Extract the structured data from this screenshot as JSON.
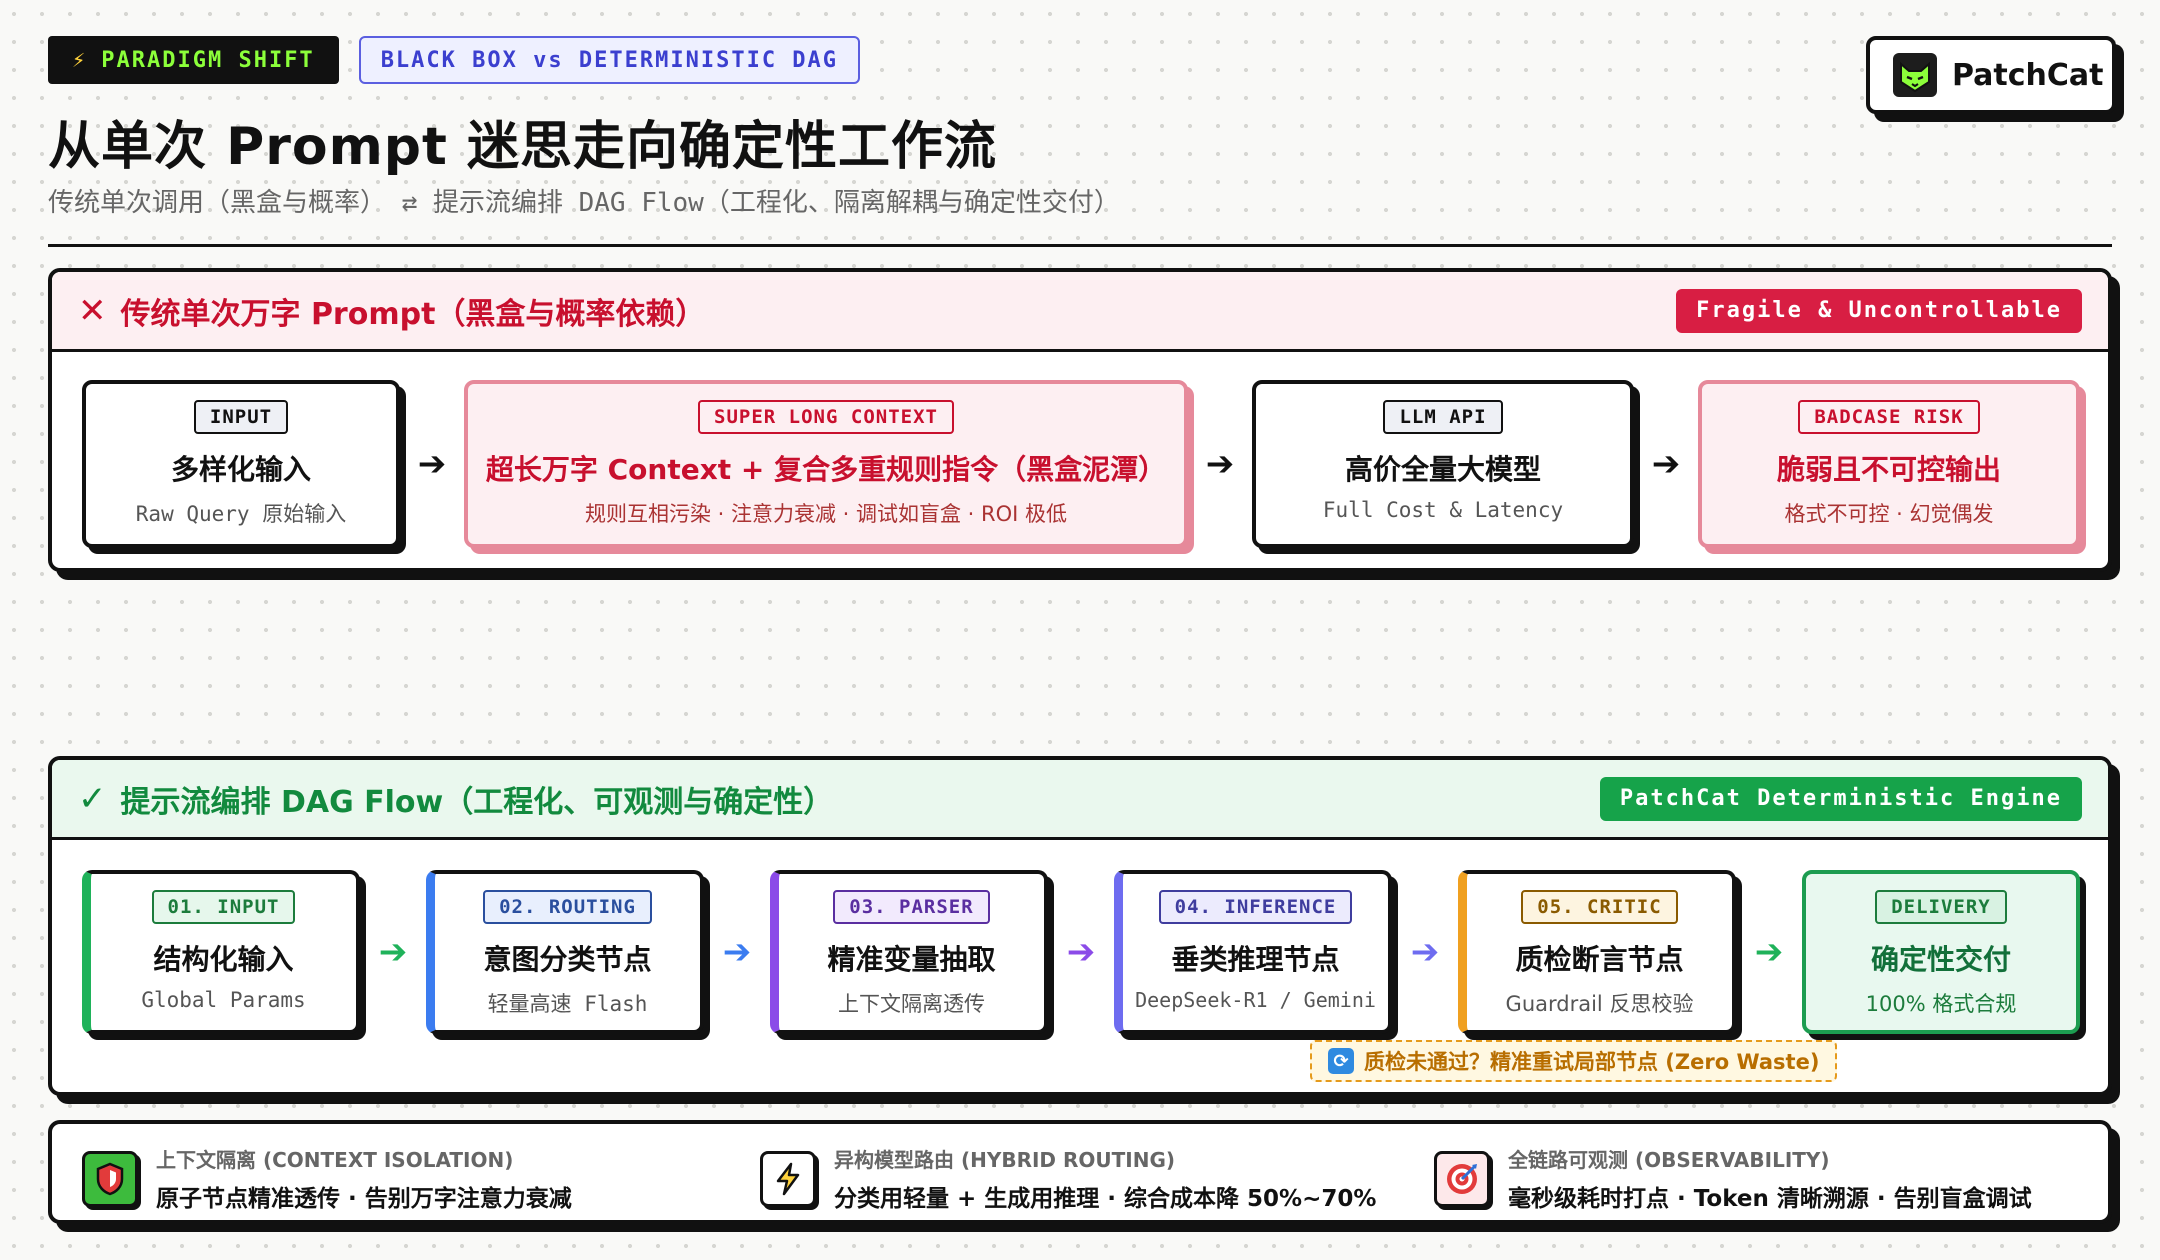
{
  "header": {
    "tag_primary": "PARADIGM SHIFT",
    "tag_secondary": "BLACK BOX vs DETERMINISTIC DAG",
    "title": "从单次 Prompt 迷思走向确定性工作流",
    "subtitle": "传统单次调用（黑盒与概率） ⇄ 提示流编排 DAG Flow（工程化、隔离解耦与确定性交付）"
  },
  "brand": {
    "name": "PatchCat"
  },
  "legacy": {
    "title": "传统单次万字 Prompt（黑盒与概率依赖）",
    "badge": "Fragile & Uncontrollable",
    "nodes": [
      {
        "tag": "INPUT",
        "title": "多样化输入",
        "sub": "Raw Query 原始输入"
      },
      {
        "tag": "SUPER LONG CONTEXT",
        "title": "超长万字 Context + 复合多重规则指令（黑盒泥潭）",
        "sub": "规则互相污染 · 注意力衰减 · 调试如盲盒 · ROI 极低"
      },
      {
        "tag": "LLM API",
        "title": "高价全量大模型",
        "sub": "Full Cost & Latency"
      },
      {
        "tag": "BADCASE RISK",
        "title": "脆弱且不可控输出",
        "sub": "格式不可控 · 幻觉偶发"
      }
    ],
    "arrow": "➔"
  },
  "dag": {
    "title": "提示流编排 DAG Flow（工程化、可观测与确定性）",
    "badge": "PatchCat Deterministic Engine",
    "nodes": [
      {
        "tag": "01. INPUT",
        "title": "结构化输入",
        "sub": "Global Params",
        "arrow_color": "#1fb25a"
      },
      {
        "tag": "02. ROUTING",
        "title": "意图分类节点",
        "sub": "轻量高速 Flash",
        "arrow_color": "#3b7cf0"
      },
      {
        "tag": "03. PARSER",
        "title": "精准变量抽取",
        "sub": "上下文隔离透传",
        "arrow_color": "#8b4be8"
      },
      {
        "tag": "04. INFERENCE",
        "title": "垂类推理节点",
        "sub": "DeepSeek-R1 / Gemini",
        "arrow_color": "#6e6cf0"
      },
      {
        "tag": "05. CRITIC",
        "title": "质检断言节点",
        "sub": "Guardrail 反思校验",
        "arrow_color": "#1fb25a"
      },
      {
        "tag": "DELIVERY",
        "title": "确定性交付",
        "sub": "100% 格式合规"
      }
    ],
    "arrow": "➔",
    "retry_note": "质检未通过？精准重试局部节点 (Zero Waste)"
  },
  "features": [
    {
      "icon": "shield-icon",
      "label": "上下文隔离 (CONTEXT ISOLATION)",
      "desc": "原子节点精准透传 · 告别万字注意力衰减"
    },
    {
      "icon": "lightning-icon",
      "label": "异构模型路由 (HYBRID ROUTING)",
      "desc": "分类用轻量 + 生成用推理 · 综合成本降 50%~70%"
    },
    {
      "icon": "target-icon",
      "label": "全链路可观测 (OBSERVABILITY)",
      "desc": "毫秒级耗时打点 · Token 清晰溯源 · 告别盲盒调试"
    }
  ],
  "colors": {
    "danger": "#d81e43",
    "success": "#16a34a",
    "accent": "#5b5fe0",
    "brand_green": "#8cff3a"
  }
}
